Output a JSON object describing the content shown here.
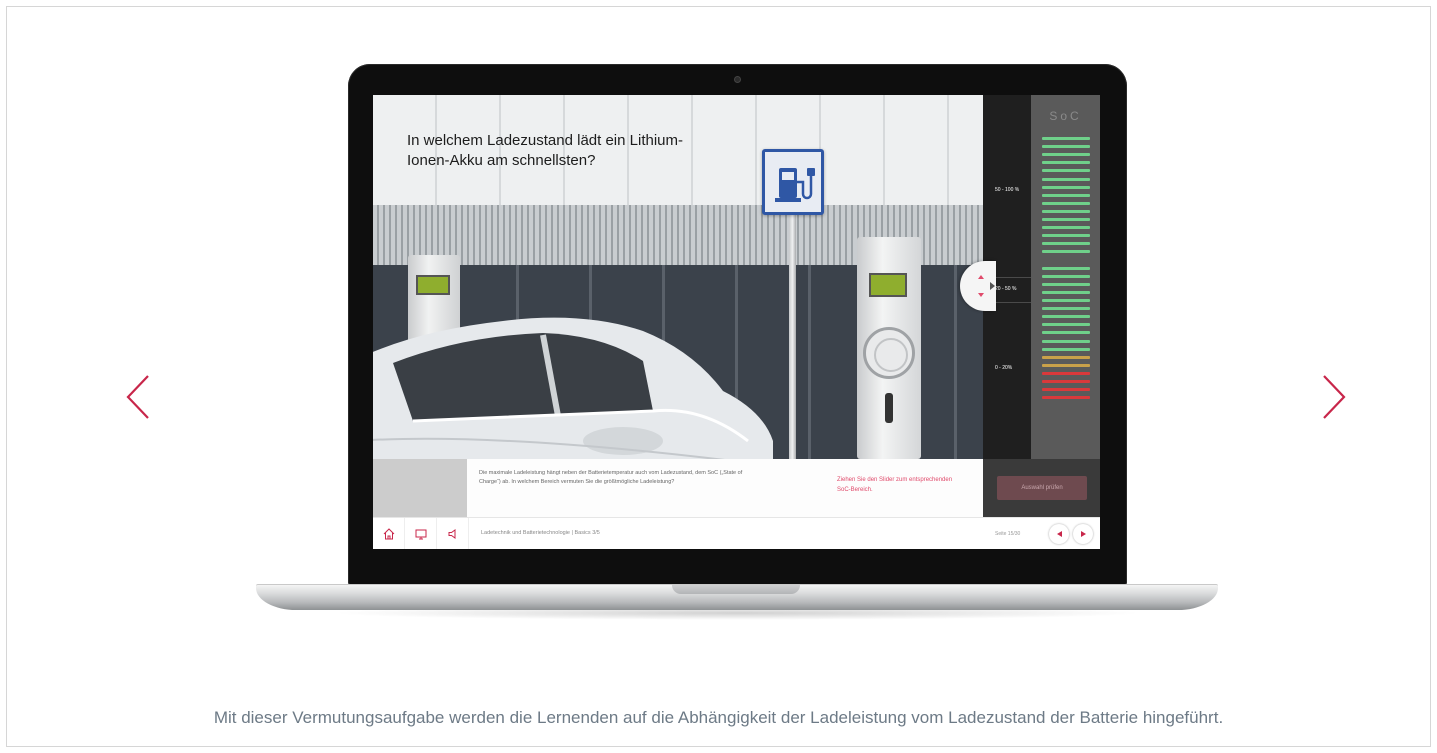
{
  "question": "In welchem Ladezustand lädt ein Lithium-Ionen-Akku am schnellsten?",
  "info_text": "Die maximale Ladeleistung hängt neben der Batterietemperatur auch vom Ladezustand, dem SoC („State of Charge“) ab. In welchem Bereich vermuten Sie die größtmögliche Ladeleistung?",
  "hint_text": "Ziehen Sie den Slider zum entsprechenden SoC-Bereich.",
  "soc": {
    "title": "SoC",
    "ranges": [
      "50 - 100 %",
      "20 - 50 %",
      "0 - 20%"
    ],
    "selected_range": "20 - 50 %"
  },
  "check_button": "Auswahl prüfen",
  "footer": {
    "breadcrumb": "Ladetechnik und Batterietechnologie  |  Basics 3/5",
    "page_label": "Seite 15/30"
  },
  "caption": "Mit dieser Vermutungsaufgabe werden die Lernenden auf die Abhängigkeit der Ladeleistung vom Ladezustand der Batterie hingeführt.",
  "icons": {
    "prev": "chevron-left-icon",
    "next": "chevron-right-icon",
    "home": "home-icon",
    "screen": "monitor-icon",
    "sound": "speaker-icon",
    "charge_sign": "charging-station-icon"
  },
  "colors": {
    "accent": "#c8264a",
    "soc_green": "#6fd08a",
    "soc_amber": "#c9a14a",
    "soc_red": "#d9393b",
    "caption_text": "#6d7a86"
  }
}
